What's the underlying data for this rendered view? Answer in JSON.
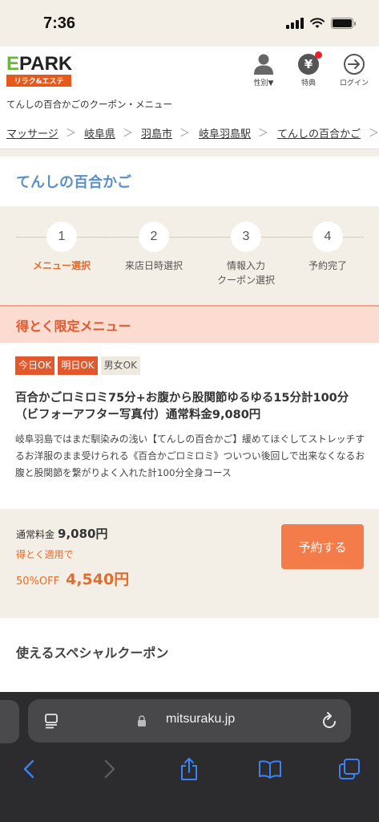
{
  "status": {
    "time": "7:36"
  },
  "header": {
    "logo_main": "PARK",
    "logo_e": "E",
    "logo_sub": "リラク&エステ",
    "buttons": [
      {
        "icon": "person-icon",
        "label": "性別▼"
      },
      {
        "icon": "yen-icon",
        "glyph": "¥",
        "label": "特典"
      },
      {
        "icon": "login-icon",
        "label": "ログイン"
      }
    ]
  },
  "subtitle": "てんしの百合かごのクーポン・メニュー",
  "breadcrumb": [
    "マッサージ",
    "岐阜県",
    "羽島市",
    "岐阜羽島駅",
    "てんしの百合かご"
  ],
  "breadcrumb_sep": "＞",
  "shop_name": "てんしの百合かご",
  "steps": [
    {
      "num": "1",
      "label": "メニュー選択",
      "active": true
    },
    {
      "num": "2",
      "label": "来店日時選択",
      "active": false
    },
    {
      "num": "3",
      "label": "情報入力\nクーポン選択",
      "active": false
    },
    {
      "num": "4",
      "label": "予約完了",
      "active": false
    }
  ],
  "tokuto_title": "得とく限定メニュー",
  "menu": {
    "badges": [
      "今日OK",
      "明日OK",
      "男女OK"
    ],
    "title": "百合かごロミロミ75分+お腹から股関節ゆるゆる15分計100分（ビフォーアフター写真付）通常料金9,080円",
    "description": "岐阜羽島ではまだ馴染みの浅い【てんしの百合かご】緩めてほぐしてストレッチするお洋服のまま受けられる《百合かごロミロミ》ついつい後回しで出来なくなるお腹と股関節を繋がりよく入れた計100分全身コース"
  },
  "price": {
    "regular_label": "通常料金",
    "regular_value": "9,080円",
    "apply_label": "得とく適用で",
    "off_label": "50%OFF",
    "off_value": "4,540円",
    "reserve_label": "予約する"
  },
  "coupon_title": "使えるスペシャルクーポン",
  "browser": {
    "url": "mitsuraku.jp"
  },
  "colors": {
    "accent": "#e2572b",
    "shop_blue": "#5a8fc8",
    "button": "#f37c4a",
    "ios_blue": "#3b82f6"
  }
}
